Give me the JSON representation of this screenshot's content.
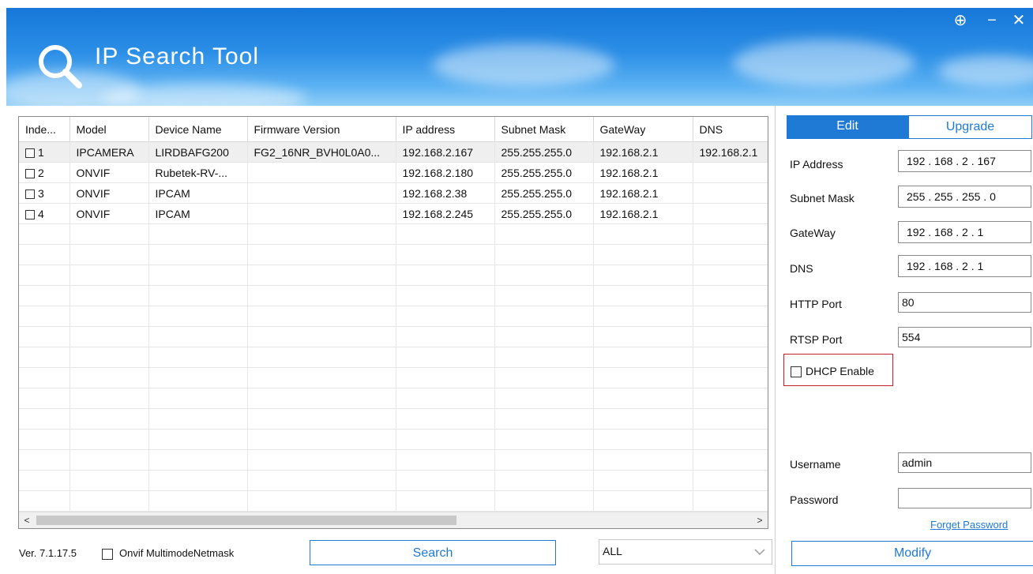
{
  "header": {
    "title": "IP Search Tool",
    "window_controls": {
      "pin": "⊕",
      "minimize": "−",
      "close": "✕"
    }
  },
  "table": {
    "columns": [
      "Inde...",
      "Model",
      "Device Name",
      "Firmware Version",
      "IP address",
      "Subnet Mask",
      "GateWay",
      "DNS"
    ],
    "rows": [
      {
        "index": "1",
        "model": "IPCAMERA",
        "device_name": "LIRDBAFG200",
        "firmware": "FG2_16NR_BVH0L0A0...",
        "ip": "192.168.2.167",
        "mask": "255.255.255.0",
        "gateway": "192.168.2.1",
        "dns": "192.168.2.1",
        "checked": false,
        "selected": true
      },
      {
        "index": "2",
        "model": "ONVIF",
        "device_name": "Rubetek-RV-...",
        "firmware": "",
        "ip": "192.168.2.180",
        "mask": "255.255.255.0",
        "gateway": "192.168.2.1",
        "dns": "",
        "checked": false,
        "selected": false
      },
      {
        "index": "3",
        "model": "ONVIF",
        "device_name": "IPCAM",
        "firmware": "",
        "ip": "192.168.2.38",
        "mask": "255.255.255.0",
        "gateway": "192.168.2.1",
        "dns": "",
        "checked": false,
        "selected": false
      },
      {
        "index": "4",
        "model": "ONVIF",
        "device_name": "IPCAM",
        "firmware": "",
        "ip": "192.168.2.245",
        "mask": "255.255.255.0",
        "gateway": "192.168.2.1",
        "dns": "",
        "checked": false,
        "selected": false
      }
    ],
    "empty_rows": 14,
    "scroll_left_arrow": "<",
    "scroll_right_arrow": ">"
  },
  "footer": {
    "version": "Ver. 7.1.17.5",
    "onvif_label": "Onvif MultimodeNetmask",
    "onvif_checked": false,
    "search_label": "Search",
    "filter_value": "ALL"
  },
  "right_panel": {
    "tabs": {
      "edit": "Edit",
      "upgrade": "Upgrade",
      "active": "edit"
    },
    "fields": {
      "ip_address": {
        "label": "IP Address",
        "value": "192 . 168 .  2  . 167"
      },
      "subnet_mask": {
        "label": "Subnet Mask",
        "value": "255 . 255 . 255 .  0"
      },
      "gateway": {
        "label": "GateWay",
        "value": "192 . 168 .  2  .  1"
      },
      "dns": {
        "label": "DNS",
        "value": "192 . 168 .  2  .  1"
      },
      "http_port": {
        "label": "HTTP Port",
        "value": "80"
      },
      "rtsp_port": {
        "label": "RTSP Port",
        "value": "554"
      },
      "username": {
        "label": "Username",
        "value": "admin"
      },
      "password": {
        "label": "Password",
        "value": ""
      }
    },
    "dhcp": {
      "label": "DHCP Enable",
      "checked": false
    },
    "forget_password": "Forget Password",
    "modify_label": "Modify"
  },
  "colors": {
    "accent": "#1f7ad6",
    "highlight_border": "#c0202a",
    "header_top": "#1677d8",
    "header_bottom": "#8fcdf7"
  }
}
